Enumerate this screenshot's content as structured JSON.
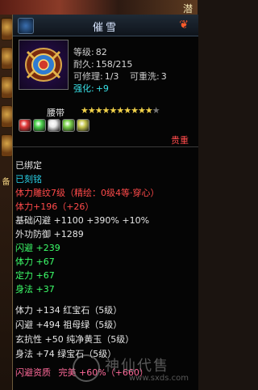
{
  "top_strip": {
    "right_text": "潜"
  },
  "left_sidebar": {
    "label": "备"
  },
  "item": {
    "title": "催雪",
    "stats": {
      "level_label": "等级:",
      "level_value": "82",
      "durability_label": "耐久:",
      "durability_value": "158/215",
      "repair_label": "可修理:",
      "repair_value": "1/3",
      "rewash_label": "可重洗:",
      "rewash_value": "3",
      "enhance_label": "强化:",
      "enhance_value": "+9"
    },
    "slot_label": "腰带",
    "stars_on": 10,
    "stars_total": 11,
    "stars_glyph_on": "★",
    "stars_glyph_off": "★",
    "gem_colors": [
      "#e23a3a",
      "#4bd24b",
      "#e8e8e8",
      "#7ad04a",
      "#c8c850"
    ],
    "rarity": "贵重"
  },
  "details": {
    "bound": "已绑定",
    "engraved": "已刻铭",
    "enhance_line": "体力雕纹7级（精绘：0级4等·穿心）",
    "stamina_bonus": "体力+196（+26）",
    "basic_dodge": "基础闪避 +1100 +390% +10%",
    "outer_def": "外功防御 +1289",
    "attrs": [
      "闪避 +239",
      "体力 +67",
      "定力 +67",
      "身法 +37"
    ],
    "gem_lines": [
      "体力 +134 红宝石（5级）",
      "闪避 +494 祖母绿（5级）",
      "玄抗性 +50 纯净黄玉（5级）",
      "身法 +74 绿宝石（5级）"
    ],
    "dodge_quality_label": "闪避资质",
    "dodge_quality_value": "完美 +60%（+660）"
  },
  "watermark": {
    "text": "神仙代售",
    "url": "www.sxds.com"
  }
}
